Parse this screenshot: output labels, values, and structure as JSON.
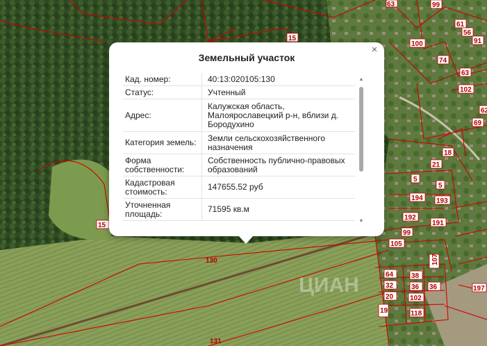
{
  "popup": {
    "title": "Земельный участок",
    "close": "×",
    "rows": [
      {
        "key": "Кад. номер:",
        "value": "40:13:020105:130"
      },
      {
        "key": "Статус:",
        "value": "Учтенный"
      },
      {
        "key": "Адрес:",
        "value": "Калужская область, Малоярославецкий р-н, вблизи д. Бородухино"
      },
      {
        "key": "Категория земель:",
        "value": "Земли сельскохозяйственного назначения"
      },
      {
        "key": "Форма собственности:",
        "value": "Собственность публично-правовых образований"
      },
      {
        "key": "Кадастровая стоимость:",
        "value": "147655.52 руб"
      },
      {
        "key": "Уточненная площадь:",
        "value": "71595 кв.м"
      }
    ],
    "scroll_up": "▲",
    "scroll_down": "▼"
  },
  "map": {
    "parcel_labels": [
      "15",
      "130",
      "131",
      "63",
      "99",
      "61",
      "56",
      "100",
      "91",
      "74",
      "63",
      "102",
      "62",
      "69",
      "18",
      "21",
      "5",
      "5",
      "194",
      "193",
      "192",
      "191",
      "99",
      "105",
      "107",
      "64",
      "38",
      "32",
      "36",
      "36",
      "20",
      "102",
      "19",
      "118",
      "197",
      "15"
    ],
    "watermark": "ЦИАН"
  }
}
